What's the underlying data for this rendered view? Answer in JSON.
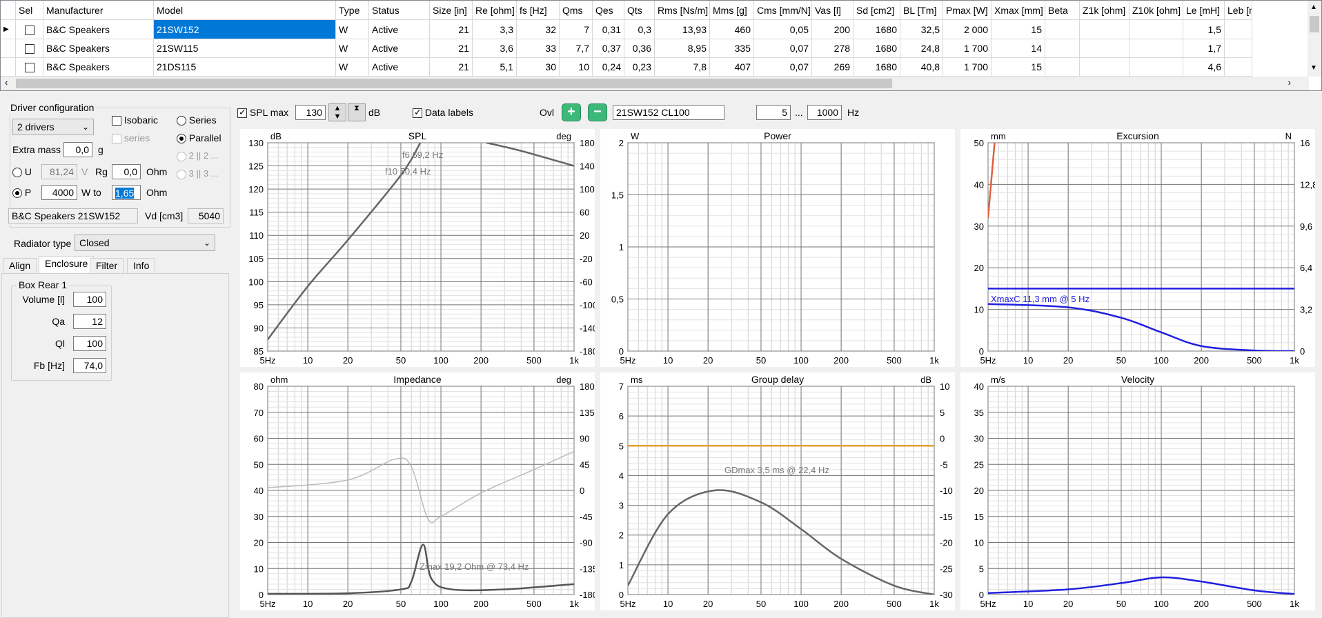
{
  "grid": {
    "columns": [
      "Sel",
      "Manufacturer",
      "Model",
      "Type",
      "Status",
      "Size [in]",
      "Re [ohm]",
      "fs [Hz]",
      "Qms",
      "Qes",
      "Qts",
      "Rms [Ns/m]",
      "Mms [g]",
      "Cms [mm/N]",
      "Vas [l]",
      "Sd [cm2]",
      "BL [Tm]",
      "Pmax [W]",
      "Xmax [mm]",
      "Beta",
      "Z1k [ohm]",
      "Z10k [ohm]",
      "Le [mH]",
      "Leb [mH"
    ],
    "rows": [
      [
        "",
        "B&C Speakers",
        "21SW152",
        "W",
        "Active",
        "21",
        "3,3",
        "32",
        "7",
        "0,31",
        "0,3",
        "13,93",
        "460",
        "0,05",
        "200",
        "1680",
        "32,5",
        "2 000",
        "15",
        "",
        "",
        "",
        "1,5",
        ""
      ],
      [
        "",
        "B&C Speakers",
        "21SW115",
        "W",
        "Active",
        "21",
        "3,6",
        "33",
        "7,7",
        "0,37",
        "0,36",
        "8,95",
        "335",
        "0,07",
        "278",
        "1680",
        "24,8",
        "1 700",
        "14",
        "",
        "",
        "",
        "1,7",
        ""
      ],
      [
        "",
        "B&C Speakers",
        "21DS115",
        "W",
        "Active",
        "21",
        "5,1",
        "30",
        "10",
        "0,24",
        "0,23",
        "7,8",
        "407",
        "0,07",
        "269",
        "1680",
        "40,8",
        "1 700",
        "15",
        "",
        "",
        "",
        "4,6",
        ""
      ]
    ]
  },
  "config": {
    "group_title": "Driver configuration",
    "drivers_value": "2 drivers",
    "isobaric_label": "Isobaric",
    "series_sub_label": "series",
    "series_label": "Series",
    "parallel_label": "Parallel",
    "opt_2p2": "2 || 2 ...",
    "opt_3p3": "3 || 3 ...",
    "extra_mass_label": "Extra mass",
    "extra_mass_value": "0,0",
    "extra_mass_unit": "g",
    "u_label": "U",
    "u_value": "81,24",
    "u_unit": "V",
    "rg_label": "Rg",
    "rg_value": "0,0",
    "rg_unit": "Ohm",
    "p_label": "P",
    "p_value": "4000",
    "wto_label": "W to",
    "wto_value": "1,65",
    "wto_unit": "Ohm",
    "driver_name": "B&C Speakers 21SW152",
    "vd_label": "Vd [cm3]",
    "vd_value": "5040",
    "radiator_label": "Radiator type",
    "radiator_value": "Closed"
  },
  "tabs": [
    "Align",
    "Enclosure",
    "Filter",
    "Info"
  ],
  "enclosure": {
    "group_title": "Box Rear 1",
    "volume_label": "Volume [l]",
    "volume_value": "100",
    "qa_label": "Qa",
    "qa_value": "12",
    "ql_label": "Ql",
    "ql_value": "100",
    "fb_label": "Fb [Hz]",
    "fb_value": "74,0"
  },
  "toolbar": {
    "splmax_label": "SPL max",
    "splmax_value": "130",
    "splmax_unit": "dB",
    "datalabels_label": "Data labels",
    "ovl_label": "Ovl",
    "ovl_name": "21SW152 CL100",
    "freq_from": "5",
    "freq_sep": "...",
    "freq_to": "1000",
    "freq_unit": "Hz"
  },
  "chart_data": [
    {
      "type": "line",
      "title": "SPL",
      "ylabel_left": "dB",
      "ylabel_right": "deg",
      "xticks": [
        "5Hz",
        "10",
        "20",
        "50",
        "100",
        "200",
        "500",
        "1k"
      ],
      "ylim": [
        85,
        130
      ],
      "yticks": [
        "130",
        "125",
        "120",
        "115",
        "110",
        "105",
        "100",
        "95",
        "90",
        "85"
      ],
      "yticks_right": [
        "180",
        "140",
        "100",
        "60",
        "20",
        "-20",
        "-60",
        "-100",
        "-140",
        "-180"
      ],
      "annotations": [
        "f6 69,2 Hz",
        "f10 50,4 Hz"
      ],
      "series": [
        {
          "x": [
            5,
            10,
            20,
            50,
            70
          ],
          "values": [
            87.5,
            99,
            109,
            123,
            130
          ],
          "color": "#666666"
        },
        {
          "x": [
            220,
            400,
            1000
          ],
          "values": [
            180,
            166,
            140
          ],
          "color": "#666666",
          "axis": "right"
        }
      ]
    },
    {
      "type": "line",
      "title": "Power",
      "ylabel_left": "W",
      "xticks": [
        "5Hz",
        "10",
        "20",
        "50",
        "100",
        "200",
        "500",
        "1k"
      ],
      "ylim": [
        0,
        2
      ],
      "yticks": [
        "2",
        "1,5",
        "1",
        "0,5",
        "0"
      ],
      "series": []
    },
    {
      "type": "line",
      "title": "Excursion",
      "ylabel_left": "mm",
      "ylabel_right": "N",
      "xticks": [
        "5Hz",
        "10",
        "20",
        "50",
        "100",
        "200",
        "500",
        "1k"
      ],
      "ylim": [
        0,
        50
      ],
      "yticks": [
        "50",
        "40",
        "30",
        "20",
        "10",
        "0"
      ],
      "yticks_right": [
        "16",
        "12,8",
        "9,6",
        "6,4",
        "3,2",
        "0"
      ],
      "annotations": [
        "XmaxC 11,3 mm  @ 5 Hz"
      ],
      "series": [
        {
          "x": [
            5,
            20,
            50,
            100,
            200,
            500,
            1000
          ],
          "values": [
            11.3,
            10.5,
            8,
            4.5,
            1.2,
            0.15,
            0
          ],
          "color": "#2020e0"
        },
        {
          "x": [
            5,
            1000
          ],
          "values": [
            15,
            15
          ],
          "color": "#2020e0"
        },
        {
          "x": [
            5,
            5.6
          ],
          "values": [
            32,
            50
          ],
          "color": "#e06040"
        }
      ]
    },
    {
      "type": "line",
      "title": "Impedance",
      "ylabel_left": "ohm",
      "ylabel_right": "deg",
      "xticks": [
        "5Hz",
        "10",
        "20",
        "50",
        "100",
        "200",
        "500",
        "1k"
      ],
      "ylim": [
        0,
        80
      ],
      "yticks": [
        "80",
        "70",
        "60",
        "50",
        "40",
        "30",
        "20",
        "10",
        "0"
      ],
      "yticks_right": [
        "180",
        "135",
        "90",
        "45",
        "0",
        "-45",
        "-90",
        "-135",
        "-180"
      ],
      "annotations": [
        "Zmax 19,2 Ohm @ 73,4 Hz"
      ],
      "series": [
        {
          "x": [
            5,
            20,
            50,
            60,
            73.4,
            85,
            120,
            300,
            1000
          ],
          "values": [
            0.3,
            0.5,
            2,
            5,
            19.2,
            6,
            2,
            2,
            4
          ],
          "color": "#555555"
        },
        {
          "x": [
            5,
            20,
            45,
            60,
            80,
            100,
            200,
            500,
            1000
          ],
          "values": [
            41,
            44,
            52,
            49,
            29,
            30,
            39,
            48,
            55
          ],
          "color": "#bbbbbb"
        }
      ]
    },
    {
      "type": "line",
      "title": "Group delay",
      "ylabel_left": "ms",
      "ylabel_right": "dB",
      "xticks": [
        "5Hz",
        "10",
        "20",
        "50",
        "100",
        "200",
        "500",
        "1k"
      ],
      "ylim": [
        0,
        7
      ],
      "yticks": [
        "7",
        "6",
        "5",
        "4",
        "3",
        "2",
        "1",
        "0"
      ],
      "yticks_right": [
        "10",
        "5",
        "0",
        "-5",
        "-10",
        "-15",
        "-20",
        "-25",
        "-30"
      ],
      "annotations": [
        "GDmax 3,5 ms  @ 22,4 Hz"
      ],
      "series": [
        {
          "x": [
            5,
            10,
            22.4,
            50,
            100,
            200,
            500,
            1000
          ],
          "values": [
            0.3,
            2.7,
            3.5,
            3.1,
            2.2,
            1.2,
            0.3,
            0
          ],
          "color": "#666666"
        },
        {
          "x": [
            5,
            1000
          ],
          "values": [
            5,
            5
          ],
          "color": "#e0a030"
        }
      ]
    },
    {
      "type": "line",
      "title": "Velocity",
      "ylabel_left": "m/s",
      "xticks": [
        "5Hz",
        "10",
        "20",
        "50",
        "100",
        "200",
        "500",
        "1k"
      ],
      "ylim": [
        0,
        40
      ],
      "yticks": [
        "40",
        "35",
        "30",
        "25",
        "20",
        "15",
        "10",
        "5",
        "0"
      ],
      "series": [
        {
          "x": [
            5,
            20,
            50,
            100,
            200,
            500,
            1000
          ],
          "values": [
            0.3,
            1,
            2.2,
            3.3,
            2.5,
            0.8,
            0.1
          ],
          "color": "#2020e0"
        }
      ]
    }
  ]
}
